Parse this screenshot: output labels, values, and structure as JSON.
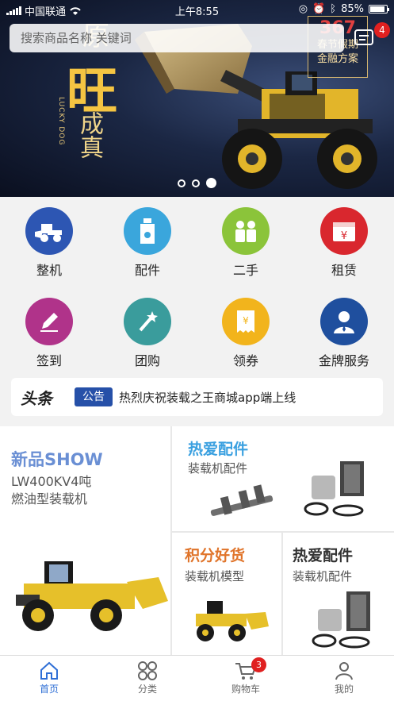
{
  "status_bar": {
    "carrier": "中国联通",
    "time": "上午8:55",
    "battery": "85%"
  },
  "search": {
    "placeholder": "搜索商品名称 关键词"
  },
  "messages": {
    "badge": "4"
  },
  "banner": {
    "slogan_1": "原",
    "slogan_2": "旺",
    "slogan_3": "成真",
    "slogan_en": "LUCKY DOG",
    "promo_number": "367",
    "promo_line_1": "春节假期",
    "promo_line_2": "金融方案",
    "slide_count": 3,
    "active_slide": 3
  },
  "categories": [
    {
      "label": "整机",
      "icon": "loader-icon",
      "color": "#2d56b3"
    },
    {
      "label": "配件",
      "icon": "oil-bottle-icon",
      "color": "#3aa6dc"
    },
    {
      "label": "二手",
      "icon": "handshake-icon",
      "color": "#8bc43a"
    },
    {
      "label": "租赁",
      "icon": "calendar-yen-icon",
      "color": "#d9272e"
    },
    {
      "label": "签到",
      "icon": "pencil-icon",
      "color": "#b0338a"
    },
    {
      "label": "团购",
      "icon": "magic-wand-icon",
      "color": "#3a9c9c"
    },
    {
      "label": "领券",
      "icon": "coupon-yen-icon",
      "color": "#f2b41c"
    },
    {
      "label": "金牌服务",
      "icon": "service-person-icon",
      "color": "#1f4f9e"
    }
  ],
  "headline": {
    "logo": "头条",
    "tag": "公告",
    "text": "热烈庆祝装载之王商城app端上线"
  },
  "products": {
    "new": {
      "title": "新品SHOW",
      "sub_1": "LW400KV4吨",
      "sub_2": "燃油型装载机"
    },
    "hot_parts": {
      "title": "热爱配件",
      "sub": "装载机配件"
    },
    "points": {
      "title": "积分好货",
      "sub": "装载机模型"
    },
    "love_parts": {
      "title": "热爱配件",
      "sub": "装载机配件"
    }
  },
  "tabbar": [
    {
      "label": "首页",
      "icon": "home-icon",
      "active": true
    },
    {
      "label": "分类",
      "icon": "category-icon",
      "active": false
    },
    {
      "label": "购物车",
      "icon": "cart-icon",
      "active": false,
      "badge": "3"
    },
    {
      "label": "我的",
      "icon": "user-icon",
      "active": false
    }
  ],
  "colors": {
    "accent": "#2f6fd6",
    "badge": "#e02020",
    "tag": "#2650a8"
  }
}
